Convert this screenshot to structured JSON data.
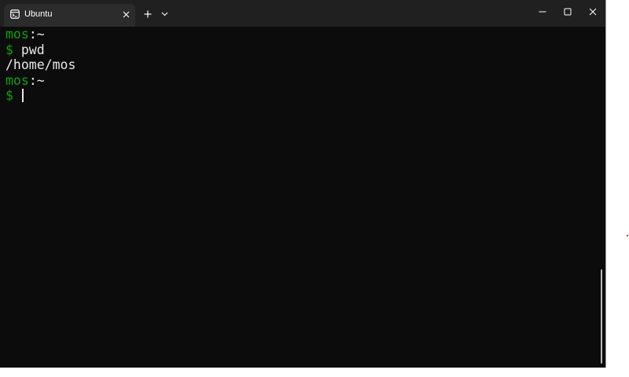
{
  "window": {
    "tab_title": "Ubuntu",
    "tab_icon": "terminal-icon",
    "new_tab_icon": "plus-icon",
    "dropdown_icon": "chevron-down-icon",
    "close_tab_icon": "close-icon",
    "controls": {
      "minimize_icon": "minimize-icon",
      "maximize_icon": "maximize-icon",
      "close_icon": "close-icon"
    }
  },
  "terminal": {
    "lines": [
      {
        "prompt_user": "mos",
        "prompt_sep": ":~"
      },
      {
        "symbol": "$",
        "command": " pwd"
      },
      {
        "output": "/home/mos"
      },
      {
        "prompt_user": "mos",
        "prompt_sep": ":~"
      },
      {
        "symbol": "$",
        "command": " "
      }
    ]
  },
  "colors": {
    "terminal_bg": "#0c0c0c",
    "titlebar_bg": "#202020",
    "tab_bg": "#2c2c2c",
    "prompt_green": "#13a10e",
    "text": "#e8e8e8"
  }
}
